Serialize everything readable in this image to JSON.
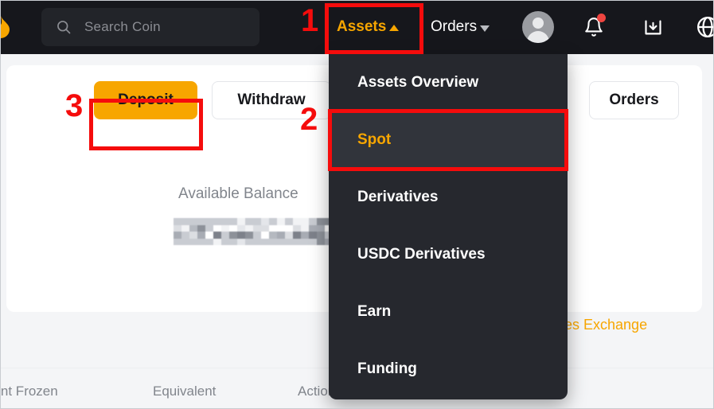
{
  "header": {
    "logo_icon": "flame-logo-icon",
    "search": {
      "placeholder": "Search Coin",
      "value": "",
      "icon": "search-icon"
    },
    "nav": {
      "assets_label": "Assets",
      "assets_caret": "caret-up-icon",
      "orders_label": "Orders",
      "orders_caret": "caret-down-icon"
    },
    "icons": {
      "avatar": "user-avatar-icon",
      "bell": "notification-bell-icon",
      "bell_has_badge": true,
      "download": "download-inbox-icon",
      "globe": "globe-language-icon"
    },
    "colors": {
      "background": "#16171c",
      "accent": "#f7a600",
      "badge": "#ef4540"
    }
  },
  "dropdown": {
    "open": true,
    "items": [
      {
        "label": "Assets Overview",
        "active": false
      },
      {
        "label": "Spot",
        "active": true
      },
      {
        "label": "Derivatives",
        "active": false
      },
      {
        "label": "USDC Derivatives",
        "active": false
      },
      {
        "label": "Earn",
        "active": false
      },
      {
        "label": "Funding",
        "active": false
      }
    ],
    "background": "#26282e",
    "active_background": "#31343b",
    "active_color": "#f7a600"
  },
  "main": {
    "buttons": {
      "deposit": "Deposit",
      "withdraw": "Withdraw",
      "orders": "Orders"
    },
    "balance": {
      "label": "Available Balance",
      "value_hidden": true
    },
    "exchange_link": "nces Exchange",
    "table": {
      "columns": [
        "ount Frozen",
        "Equivalent",
        "Action"
      ]
    },
    "colors": {
      "page_background": "#f4f5f7",
      "card_background": "#ffffff",
      "deposit_button": "#f7a600",
      "muted_text": "#81858c"
    }
  },
  "annotations": {
    "markers": [
      {
        "number": "1",
        "target": "assets-nav-button"
      },
      {
        "number": "2",
        "target": "dropdown-item-spot"
      },
      {
        "number": "3",
        "target": "deposit-button"
      }
    ],
    "color": "#f50c0c"
  }
}
